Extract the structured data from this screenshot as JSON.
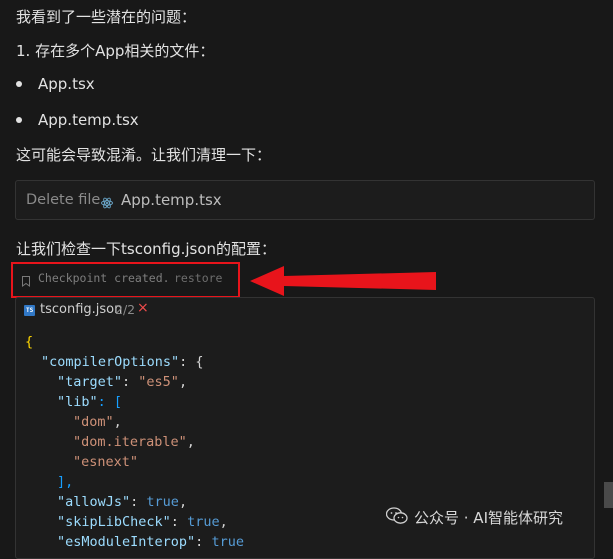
{
  "chat": {
    "line1": "我看到了一些潜在的问题：",
    "line2": "1. 存在多个App相关的文件：",
    "bullets": [
      "App.tsx",
      "App.temp.tsx"
    ],
    "line3": "这可能会导致混淆。让我们清理一下：",
    "line4": "让我们检查一下tsconfig.json的配置："
  },
  "delete_card": {
    "action": "Delete file",
    "icon": "react-icon",
    "filename": "App.temp.tsx"
  },
  "checkpoint": {
    "text": "Checkpoint created.",
    "restore": "restore"
  },
  "file_card": {
    "icon_label": "TS",
    "filename": "tsconfig.json",
    "version": "2/2",
    "close": "×"
  },
  "code": {
    "l1": "{",
    "l2_key": "\"compilerOptions\"",
    "l2_rest": ": {",
    "l3_key": "\"target\"",
    "l3_val": "\"es5\"",
    "l4_key": "\"lib\"",
    "l4_rest": ": [",
    "l5": "\"dom\"",
    "l6": "\"dom.iterable\"",
    "l7": "\"esnext\"",
    "l8": "],",
    "l9_key": "\"allowJs\"",
    "l9_val": "true",
    "l10_key": "\"skipLibCheck\"",
    "l10_val": "true",
    "l11_key": "\"esModuleInterop\"",
    "l11_val": "true"
  },
  "watermark": {
    "text": "公众号 · AI智能体研究"
  },
  "colors": {
    "annotation_red": "#e8141b",
    "background": "#181818"
  }
}
